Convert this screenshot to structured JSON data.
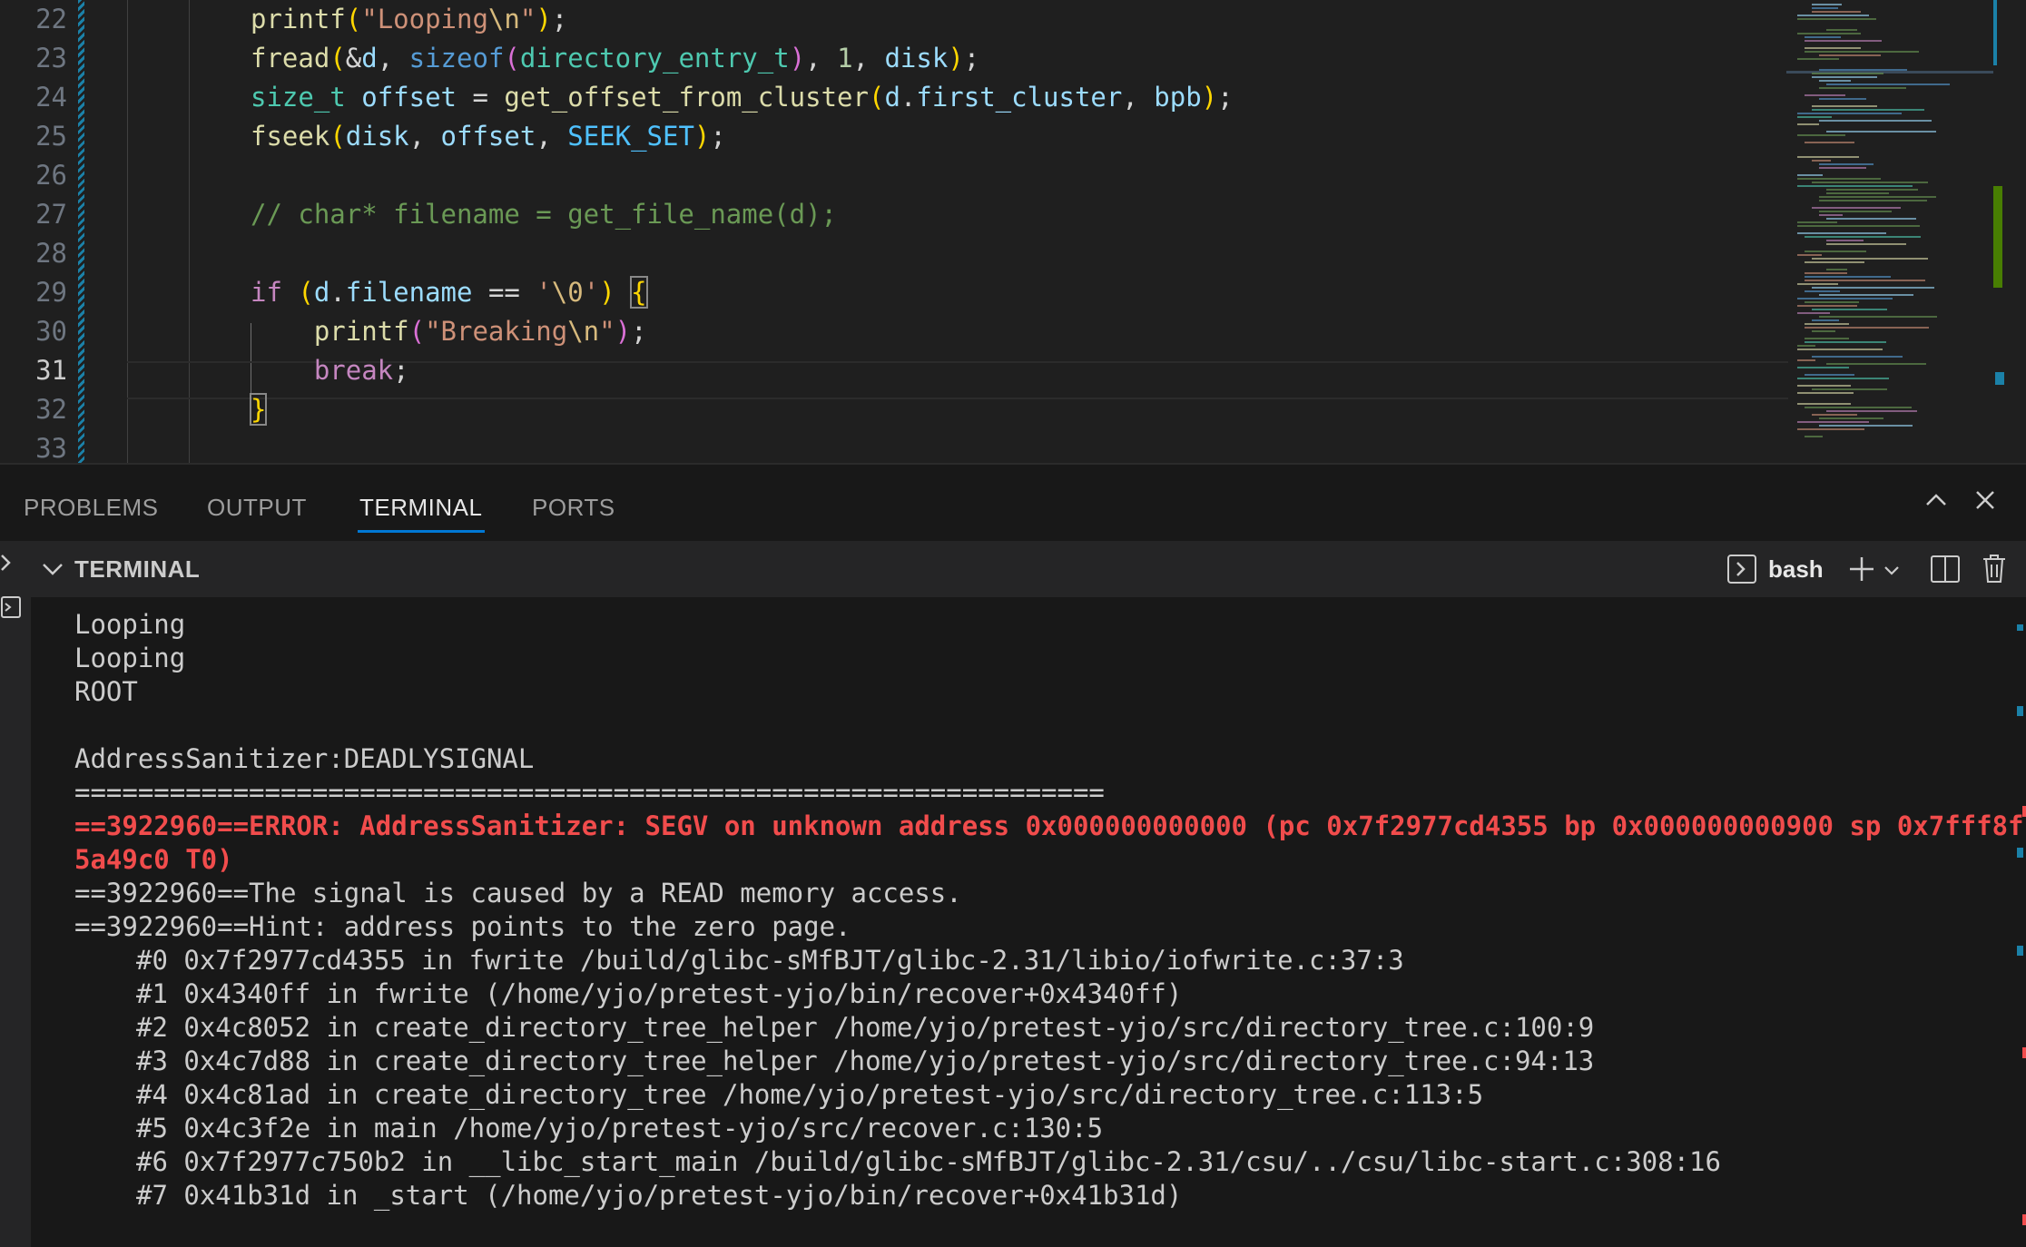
{
  "editor": {
    "line_numbers": [
      "22",
      "23",
      "24",
      "25",
      "26",
      "27",
      "28",
      "29",
      "30",
      "31",
      "32",
      "33"
    ],
    "active_line": "31",
    "code": [
      [
        [
          "t-fn",
          "printf"
        ],
        [
          "t-b1",
          "("
        ],
        [
          "t-str",
          "\"Looping"
        ],
        [
          "t-esc",
          "\\n"
        ],
        [
          "t-str",
          "\""
        ],
        [
          "t-b1",
          ")"
        ],
        [
          "t-op",
          ";"
        ]
      ],
      [
        [
          "t-fn",
          "fread"
        ],
        [
          "t-b1",
          "("
        ],
        [
          "t-op",
          "&"
        ],
        [
          "t-var",
          "d"
        ],
        [
          "t-op",
          ", "
        ],
        [
          "t-kw",
          "sizeof"
        ],
        [
          "t-b2",
          "("
        ],
        [
          "t-type",
          "directory_entry_t"
        ],
        [
          "t-b2",
          ")"
        ],
        [
          "t-op",
          ", "
        ],
        [
          "t-num",
          "1"
        ],
        [
          "t-op",
          ", "
        ],
        [
          "t-var",
          "disk"
        ],
        [
          "t-b1",
          ")"
        ],
        [
          "t-op",
          ";"
        ]
      ],
      [
        [
          "t-type",
          "size_t"
        ],
        [
          "t-op",
          " "
        ],
        [
          "t-var",
          "offset"
        ],
        [
          "t-op",
          " = "
        ],
        [
          "t-fn",
          "get_offset_from_cluster"
        ],
        [
          "t-b1",
          "("
        ],
        [
          "t-var",
          "d"
        ],
        [
          "t-op",
          "."
        ],
        [
          "t-var",
          "first_cluster"
        ],
        [
          "t-op",
          ", "
        ],
        [
          "t-var",
          "bpb"
        ],
        [
          "t-b1",
          ")"
        ],
        [
          "t-op",
          ";"
        ]
      ],
      [
        [
          "t-fn",
          "fseek"
        ],
        [
          "t-b1",
          "("
        ],
        [
          "t-var",
          "disk"
        ],
        [
          "t-op",
          ", "
        ],
        [
          "t-var",
          "offset"
        ],
        [
          "t-op",
          ", "
        ],
        [
          "t-const",
          "SEEK_SET"
        ],
        [
          "t-b1",
          ")"
        ],
        [
          "t-op",
          ";"
        ]
      ],
      [],
      [
        [
          "t-cmt",
          "// char* filename = get_file_name(d);"
        ]
      ],
      [],
      [
        [
          "t-ctl",
          "if"
        ],
        [
          "t-op",
          " "
        ],
        [
          "t-b1",
          "("
        ],
        [
          "t-var",
          "d"
        ],
        [
          "t-op",
          "."
        ],
        [
          "t-var",
          "filename"
        ],
        [
          "t-op",
          " == "
        ],
        [
          "t-str",
          "'"
        ],
        [
          "t-esc",
          "\\0"
        ],
        [
          "t-str",
          "'"
        ],
        [
          "t-b1",
          ")"
        ],
        [
          "t-op",
          " "
        ],
        [
          "t-b1 bm",
          "{"
        ]
      ],
      [
        [
          "t-op",
          "    "
        ],
        [
          "t-fn",
          "printf"
        ],
        [
          "t-b2",
          "("
        ],
        [
          "t-str",
          "\"Breaking"
        ],
        [
          "t-esc",
          "\\n"
        ],
        [
          "t-str",
          "\""
        ],
        [
          "t-b2",
          ")"
        ],
        [
          "t-op",
          ";"
        ]
      ],
      [
        [
          "t-op",
          "    "
        ],
        [
          "t-ctl",
          "break"
        ],
        [
          "t-op",
          ";"
        ]
      ],
      [
        [
          "t-b1 bm",
          "}"
        ]
      ],
      []
    ]
  },
  "panel": {
    "tabs": [
      {
        "label": "PROBLEMS",
        "active": false
      },
      {
        "label": "OUTPUT",
        "active": false
      },
      {
        "label": "TERMINAL",
        "active": true
      },
      {
        "label": "PORTS",
        "active": false
      }
    ],
    "maximize_icon": "chevron-up-icon",
    "close_icon": "close-icon"
  },
  "terminal": {
    "section_title": "TERMINAL",
    "shell_name": "bash",
    "lines": [
      {
        "text": "Looping",
        "style": "normal"
      },
      {
        "text": "Looping",
        "style": "normal"
      },
      {
        "text": "ROOT",
        "style": "normal"
      },
      {
        "text": "",
        "style": "normal"
      },
      {
        "text": "AddressSanitizer:DEADLYSIGNAL",
        "style": "normal"
      },
      {
        "text": "=================================================================",
        "style": "normal"
      },
      {
        "text": "==3922960==ERROR: AddressSanitizer: SEGV on unknown address 0x000000000000 (pc 0x7f2977cd4355 bp 0x000000000900 sp 0x7fff8f",
        "style": "err"
      },
      {
        "text": "5a49c0 T0)",
        "style": "err"
      },
      {
        "text": "==3922960==The signal is caused by a READ memory access.",
        "style": "normal"
      },
      {
        "text": "==3922960==Hint: address points to the zero page.",
        "style": "normal"
      },
      {
        "text": "#0 0x7f2977cd4355 in fwrite /build/glibc-sMfBJT/glibc-2.31/libio/iofwrite.c:37:3",
        "style": "trace"
      },
      {
        "text": "#1 0x4340ff in fwrite (/home/yjo/pretest-yjo/bin/recover+0x4340ff)",
        "style": "trace"
      },
      {
        "text": "#2 0x4c8052 in create_directory_tree_helper /home/yjo/pretest-yjo/src/directory_tree.c:100:9",
        "style": "trace"
      },
      {
        "text": "#3 0x4c7d88 in create_directory_tree_helper /home/yjo/pretest-yjo/src/directory_tree.c:94:13",
        "style": "trace"
      },
      {
        "text": "#4 0x4c81ad in create_directory_tree /home/yjo/pretest-yjo/src/directory_tree.c:113:5",
        "style": "trace"
      },
      {
        "text": "#5 0x4c3f2e in main /home/yjo/pretest-yjo/src/recover.c:130:5",
        "style": "trace"
      },
      {
        "text": "#6 0x7f2977c750b2 in __libc_start_main /build/glibc-sMfBJT/glibc-2.31/csu/../csu/libc-start.c:308:16",
        "style": "trace"
      },
      {
        "text": "#7 0x41b31d in _start (/home/yjo/pretest-yjo/bin/recover+0x41b31d)",
        "style": "trace"
      }
    ]
  },
  "colors": {
    "accent": "#0078d4",
    "error_text": "#f14c4c",
    "editor_bg": "#1f1f1f",
    "panel_bg": "#181818"
  }
}
